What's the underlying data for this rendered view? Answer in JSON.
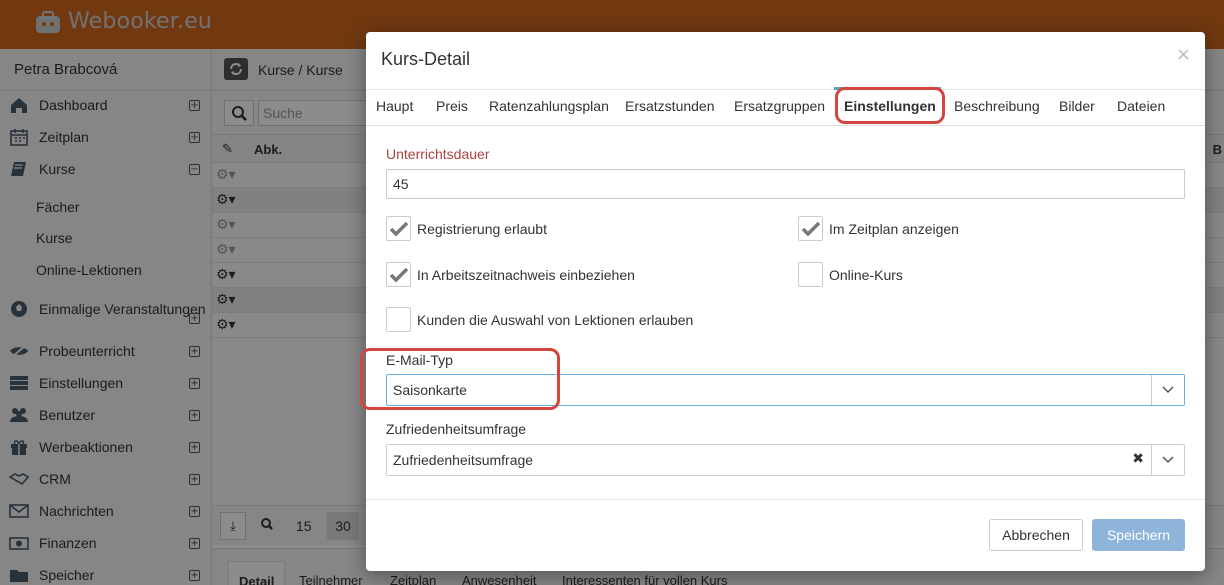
{
  "app": {
    "logo_text": "Webooker.eu"
  },
  "sidebar": {
    "user_name": "Petra Brabcová",
    "items": [
      {
        "label": "Dashboard",
        "icon": "home-icon",
        "toggle": "+"
      },
      {
        "label": "Zeitplan",
        "icon": "calendar-icon",
        "toggle": "+"
      },
      {
        "label": "Kurse",
        "icon": "book-icon",
        "toggle": "−"
      },
      {
        "label": "Einmalige Veranstaltungen",
        "icon": "ball-icon",
        "toggle": "+"
      },
      {
        "label": "Probeunterricht",
        "icon": "eye-slash-icon",
        "toggle": "+"
      },
      {
        "label": "Einstellungen",
        "icon": "server-icon",
        "toggle": "+"
      },
      {
        "label": "Benutzer",
        "icon": "users-icon",
        "toggle": "+"
      },
      {
        "label": "Werbeaktionen",
        "icon": "gift-icon",
        "toggle": "+"
      },
      {
        "label": "CRM",
        "icon": "handshake-icon",
        "toggle": "+"
      },
      {
        "label": "Nachrichten",
        "icon": "envelope-icon",
        "toggle": "+"
      },
      {
        "label": "Finanzen",
        "icon": "money-icon",
        "toggle": "+"
      },
      {
        "label": "Speicher",
        "icon": "folder-icon",
        "toggle": "+"
      }
    ],
    "sub_items": [
      "Fächer",
      "Kurse",
      "Online-Lektionen"
    ]
  },
  "content": {
    "breadcrumb": "Kurse / Kurse",
    "search_placeholder": "Suche",
    "grid_header_abk": "Abk.",
    "grid_header_b": "B",
    "pager": {
      "size1": "15",
      "size2": "30"
    },
    "bottom_tabs": [
      "Detail",
      "Teilnehmer",
      "Zeitplan",
      "Anwesenheit",
      "Interessenten für vollen Kurs"
    ]
  },
  "modal": {
    "title": "Kurs-Detail",
    "close": "×",
    "tabs": [
      "Haupt",
      "Preis",
      "Ratenzahlungsplan",
      "Ersatzstunden",
      "Ersatzgruppen",
      "Einstellungen",
      "Beschreibung",
      "Bilder",
      "Dateien"
    ],
    "active_tab": "Einstellungen",
    "unterrichtsdauer": {
      "label": "Unterrichtsdauer",
      "value": "45"
    },
    "checkboxes": [
      {
        "label": "Registrierung erlaubt",
        "checked": true
      },
      {
        "label": "Im Zeitplan anzeigen",
        "checked": true
      },
      {
        "label": "In Arbeitszeitnachweis einbeziehen",
        "checked": true
      },
      {
        "label": "Online-Kurs",
        "checked": false
      },
      {
        "label": "Kunden die Auswahl von Lektionen erlauben",
        "checked": false
      }
    ],
    "email_typ": {
      "label": "E-Mail-Typ",
      "value": "Saisonkarte"
    },
    "zufriedenheit": {
      "label": "Zufriedenheitsumfrage",
      "value": "Zufriedenheitsumfrage",
      "clear": "✖"
    },
    "buttons": {
      "cancel": "Abbrechen",
      "save": "Speichern"
    }
  },
  "colors": {
    "brand": "#d0691f",
    "accent": "#5fa1b9",
    "highlight": "#d4453d",
    "save": "#8fb4d9"
  }
}
